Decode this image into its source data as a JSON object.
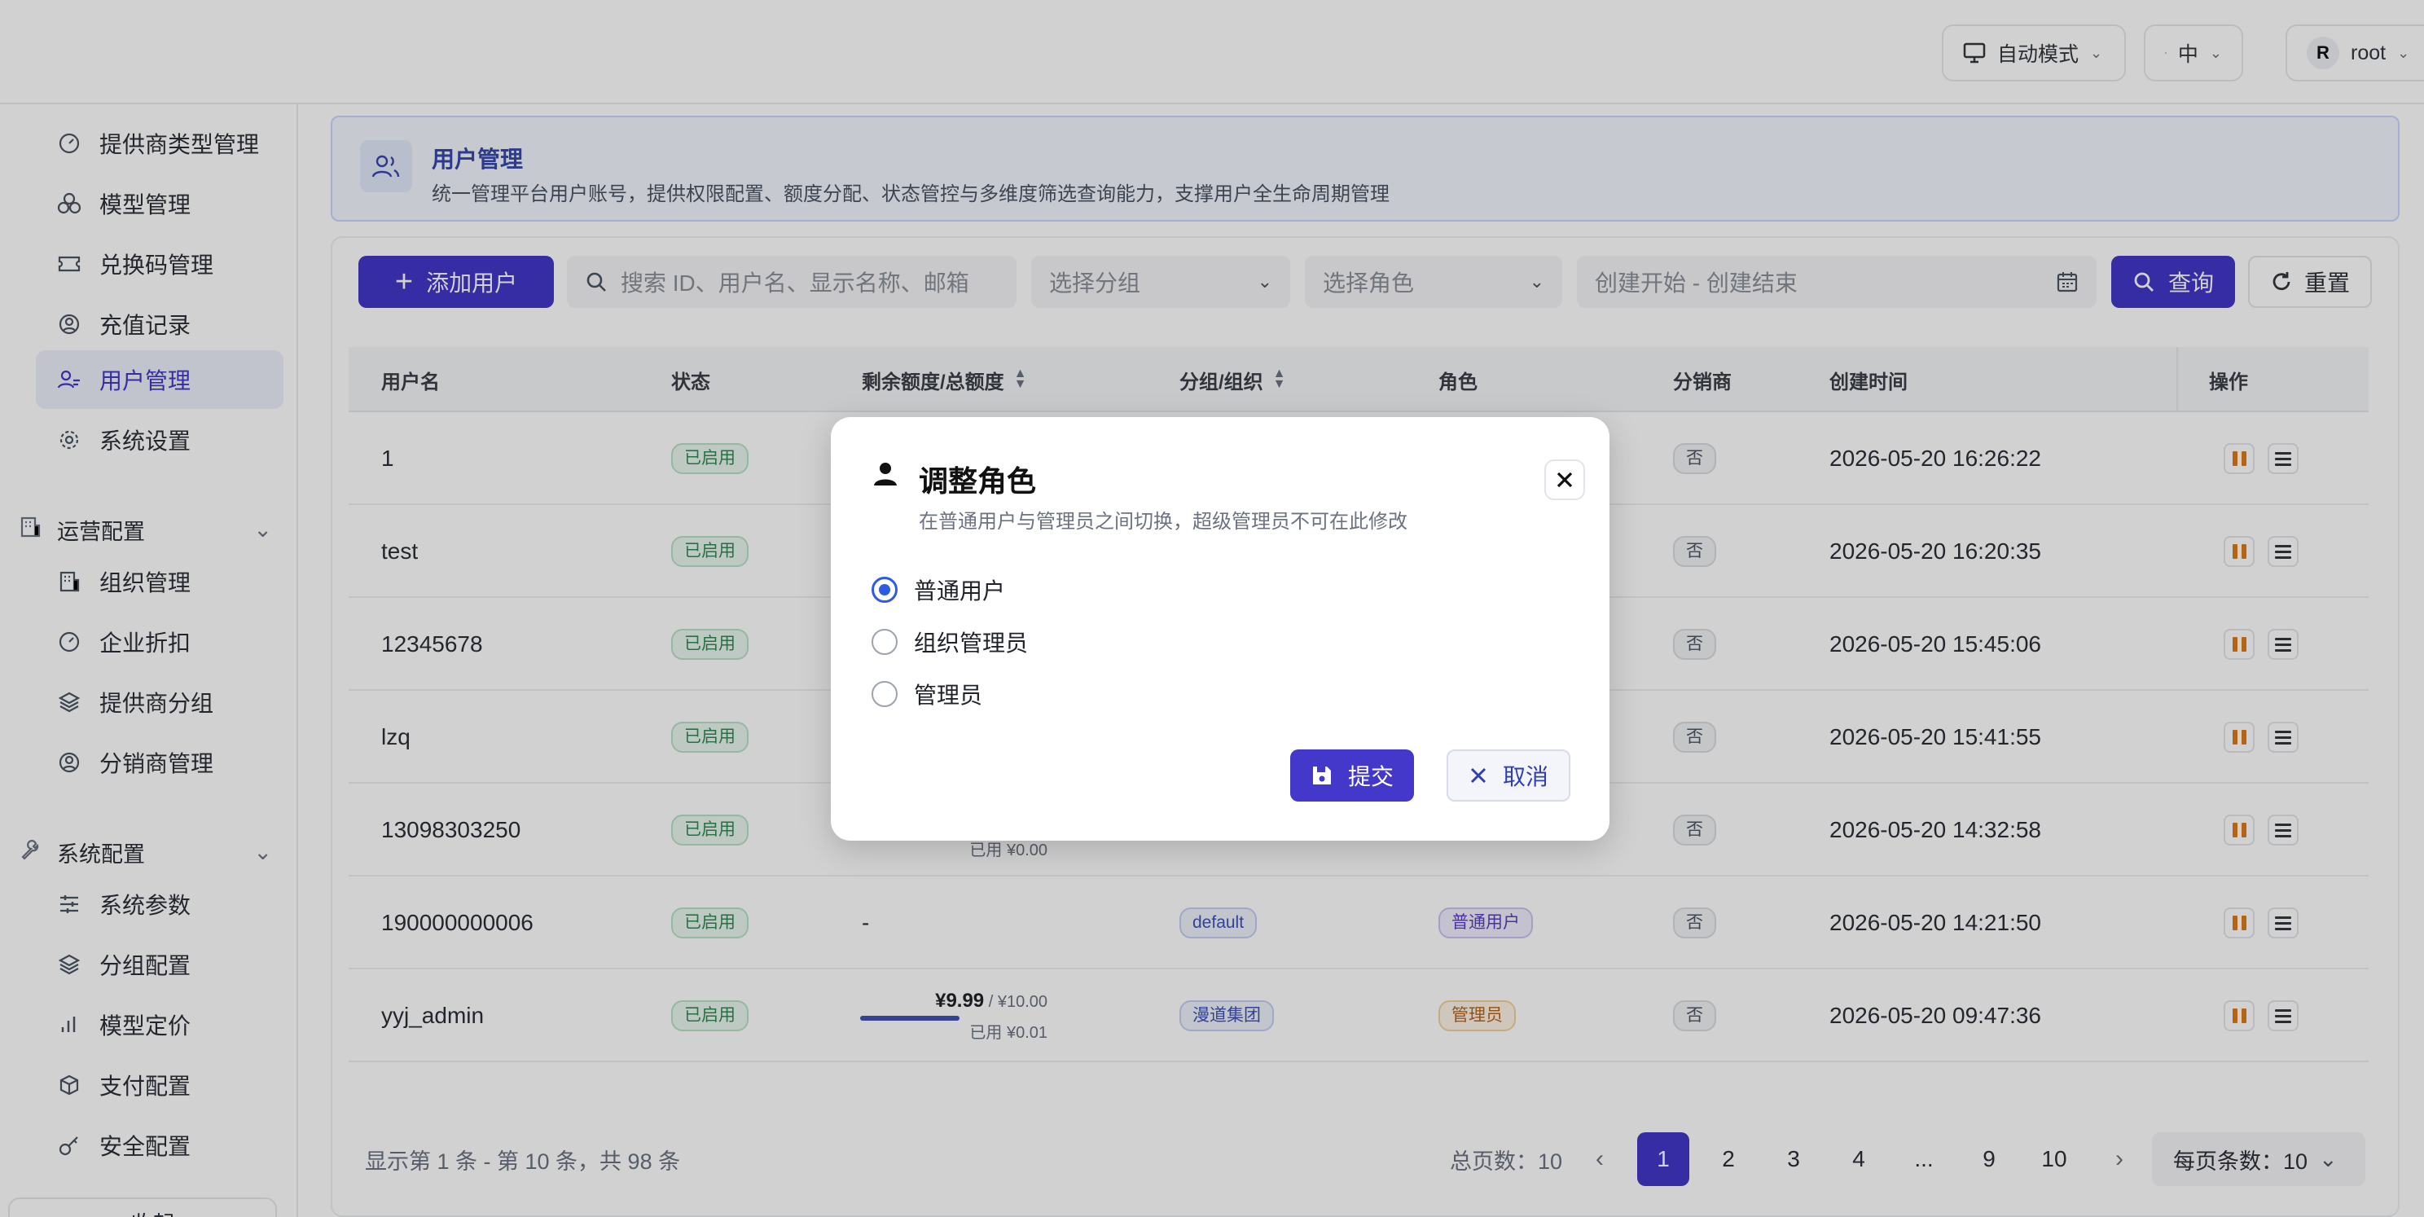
{
  "header": {
    "mode_label": "自动模式",
    "lang_label": "中",
    "user_initial": "R",
    "user_name": "root"
  },
  "sidebar": {
    "items_top": [
      {
        "label": "提供商类型管理",
        "icon": "gauge-icon"
      },
      {
        "label": "模型管理",
        "icon": "cubes-icon"
      },
      {
        "label": "兑换码管理",
        "icon": "ticket-icon"
      },
      {
        "label": "充值记录",
        "icon": "user-circle-icon"
      },
      {
        "label": "用户管理",
        "icon": "users-icon",
        "active": true
      },
      {
        "label": "系统设置",
        "icon": "gear-icon"
      }
    ],
    "group_ops": {
      "label": "运营配置",
      "icon": "building-icon"
    },
    "items_ops": [
      {
        "label": "组织管理",
        "icon": "building-icon"
      },
      {
        "label": "企业折扣",
        "icon": "gauge-icon"
      },
      {
        "label": "提供商分组",
        "icon": "layers-icon"
      },
      {
        "label": "分销商管理",
        "icon": "user-circle-icon"
      }
    ],
    "group_sys": {
      "label": "系统配置",
      "icon": "wrench-icon"
    },
    "items_sys": [
      {
        "label": "系统参数",
        "icon": "sliders-icon"
      },
      {
        "label": "分组配置",
        "icon": "layers-icon"
      },
      {
        "label": "模型定价",
        "icon": "bar-chart-icon"
      },
      {
        "label": "支付配置",
        "icon": "box-icon"
      },
      {
        "label": "安全配置",
        "icon": "key-icon"
      }
    ],
    "collapse_label": "收起"
  },
  "banner": {
    "title": "用户管理",
    "desc": "统一管理平台用户账号，提供权限配置、额度分配、状态管控与多维度筛选查询能力，支撑用户全生命周期管理"
  },
  "toolbar": {
    "add_label": "添加用户",
    "search_placeholder": "搜索 ID、用户名、显示名称、邮箱",
    "group_placeholder": "选择分组",
    "role_placeholder": "选择角色",
    "date_placeholder": "创建开始 - 创建结束",
    "query_label": "查询",
    "reset_label": "重置"
  },
  "table": {
    "headers": {
      "username": "用户名",
      "status": "状态",
      "quota": "剩余额度/总额度",
      "group": "分组/组织",
      "role": "角色",
      "distributor": "分销商",
      "created": "创建时间",
      "ops": "操作"
    },
    "rows": [
      {
        "username": "1",
        "status": "已启用",
        "distributor": "否",
        "created": "2026-05-20 16:26:22"
      },
      {
        "username": "test",
        "status": "已启用",
        "distributor": "否",
        "created": "2026-05-20 16:20:35"
      },
      {
        "username": "12345678",
        "status": "已启用",
        "distributor": "否",
        "created": "2026-05-20 15:45:06"
      },
      {
        "username": "lzq",
        "status": "已启用",
        "distributor": "否",
        "created": "2026-05-20 15:41:55"
      },
      {
        "username": "13098303250",
        "status": "已启用",
        "quota_used": "已用 ¥0.00",
        "distributor": "否",
        "created": "2026-05-20 14:32:58"
      },
      {
        "username": "190000000006",
        "status": "已启用",
        "quota_text": "-",
        "group": "default",
        "role": "普通用户",
        "distributor": "否",
        "created": "2026-05-20 14:21:50"
      },
      {
        "username": "yyj_admin",
        "status": "已启用",
        "quota_remain": "¥9.99",
        "quota_total": " / ¥10.00",
        "quota_used": "已用 ¥0.01",
        "quota_fraction": 0.999,
        "group": "漫道集团",
        "role": "管理员",
        "distributor": "否",
        "created": "2026-05-20 09:47:36"
      }
    ]
  },
  "pagination": {
    "info": "显示第 1 条 - 第 10 条，共 98 条",
    "total_pages": "总页数：10",
    "pages": [
      "1",
      "2",
      "3",
      "4",
      "...",
      "9",
      "10"
    ],
    "current": "1",
    "per_page": "每页条数：10"
  },
  "modal": {
    "title": "调整角色",
    "desc": "在普通用户与管理员之间切换，超级管理员不可在此修改",
    "options": [
      "普通用户",
      "组织管理员",
      "管理员"
    ],
    "selected": "普通用户",
    "submit_label": "提交",
    "cancel_label": "取消"
  },
  "colors": {
    "primary": "#4338ca",
    "radio_selected": "#2d5be3",
    "pause_icon": "#e07b16"
  }
}
